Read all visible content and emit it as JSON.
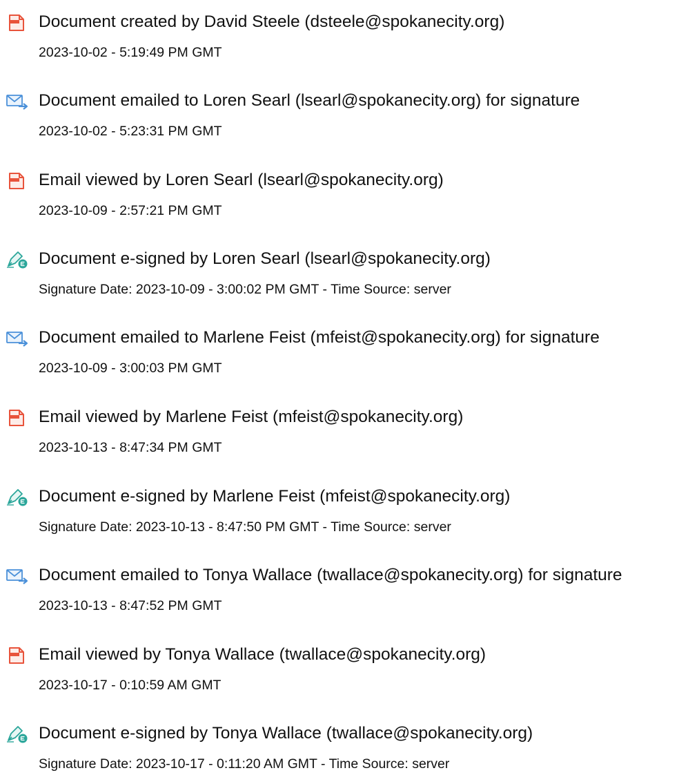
{
  "colors": {
    "text": "#111111",
    "doc_icon": "#e8533b",
    "email_icon": "#4a90d9",
    "sign_icon": "#2ba69a"
  },
  "events": [
    {
      "icon": "document-icon",
      "title": "Document created by David Steele (dsteele@spokanecity.org)",
      "meta": "2023-10-02 - 5:19:49 PM GMT"
    },
    {
      "icon": "email-sent-icon",
      "title": "Document emailed to Loren Searl (lsearl@spokanecity.org) for signature",
      "meta": "2023-10-02 - 5:23:31 PM GMT"
    },
    {
      "icon": "document-icon",
      "title": "Email viewed by Loren Searl (lsearl@spokanecity.org)",
      "meta": "2023-10-09 - 2:57:21 PM GMT"
    },
    {
      "icon": "esign-icon",
      "title": "Document e-signed by Loren Searl (lsearl@spokanecity.org)",
      "meta": "Signature Date: 2023-10-09 - 3:00:02 PM GMT - Time Source: server"
    },
    {
      "icon": "email-sent-icon",
      "title": "Document emailed to Marlene Feist (mfeist@spokanecity.org) for signature",
      "meta": "2023-10-09 - 3:00:03 PM GMT"
    },
    {
      "icon": "document-icon",
      "title": "Email viewed by Marlene Feist (mfeist@spokanecity.org)",
      "meta": "2023-10-13 - 8:47:34 PM GMT"
    },
    {
      "icon": "esign-icon",
      "title": "Document e-signed by Marlene Feist (mfeist@spokanecity.org)",
      "meta": "Signature Date: 2023-10-13 - 8:47:50 PM GMT - Time Source: server"
    },
    {
      "icon": "email-sent-icon",
      "title": "Document emailed to Tonya Wallace (twallace@spokanecity.org) for signature",
      "meta": "2023-10-13 - 8:47:52 PM GMT"
    },
    {
      "icon": "document-icon",
      "title": "Email viewed by Tonya Wallace (twallace@spokanecity.org)",
      "meta": "2023-10-17 - 0:10:59 AM GMT"
    },
    {
      "icon": "esign-icon",
      "title": "Document e-signed by Tonya Wallace (twallace@spokanecity.org)",
      "meta": "Signature Date: 2023-10-17 - 0:11:20 AM GMT - Time Source: server"
    }
  ]
}
